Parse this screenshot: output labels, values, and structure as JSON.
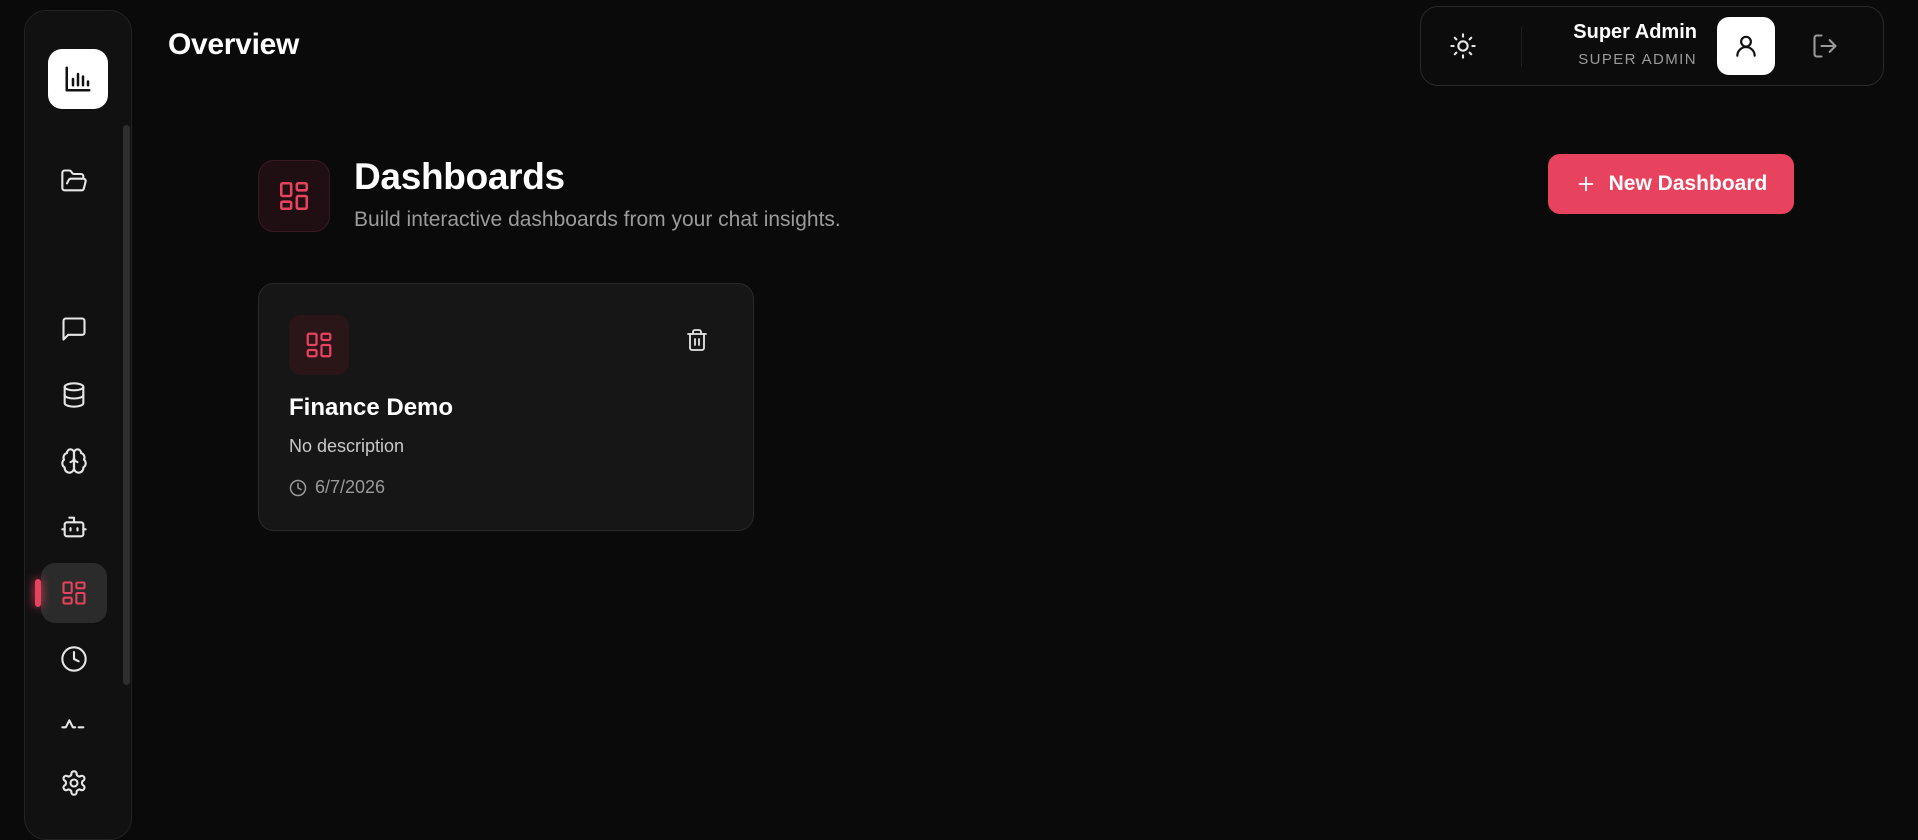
{
  "header": {
    "title": "Overview"
  },
  "user": {
    "name": "Super Admin",
    "role": "SUPER ADMIN"
  },
  "sidebar": {
    "items": [
      {
        "icon": "folder-open-icon"
      },
      {
        "icon": "chat-icon"
      },
      {
        "icon": "database-icon"
      },
      {
        "icon": "brain-icon"
      },
      {
        "icon": "bot-icon"
      },
      {
        "icon": "dashboard-icon",
        "active": true
      },
      {
        "icon": "clock-icon"
      },
      {
        "icon": "activity-icon"
      },
      {
        "icon": "gear-icon"
      }
    ]
  },
  "main": {
    "section_title": "Dashboards",
    "section_subtitle": "Build interactive dashboards from your chat insights.",
    "new_button_label": "New Dashboard",
    "cards": [
      {
        "title": "Finance Demo",
        "description": "No description",
        "date": "6/7/2026"
      }
    ]
  },
  "colors": {
    "accent": "#e8435e",
    "background": "#0a0a0a",
    "card": "#161616"
  }
}
